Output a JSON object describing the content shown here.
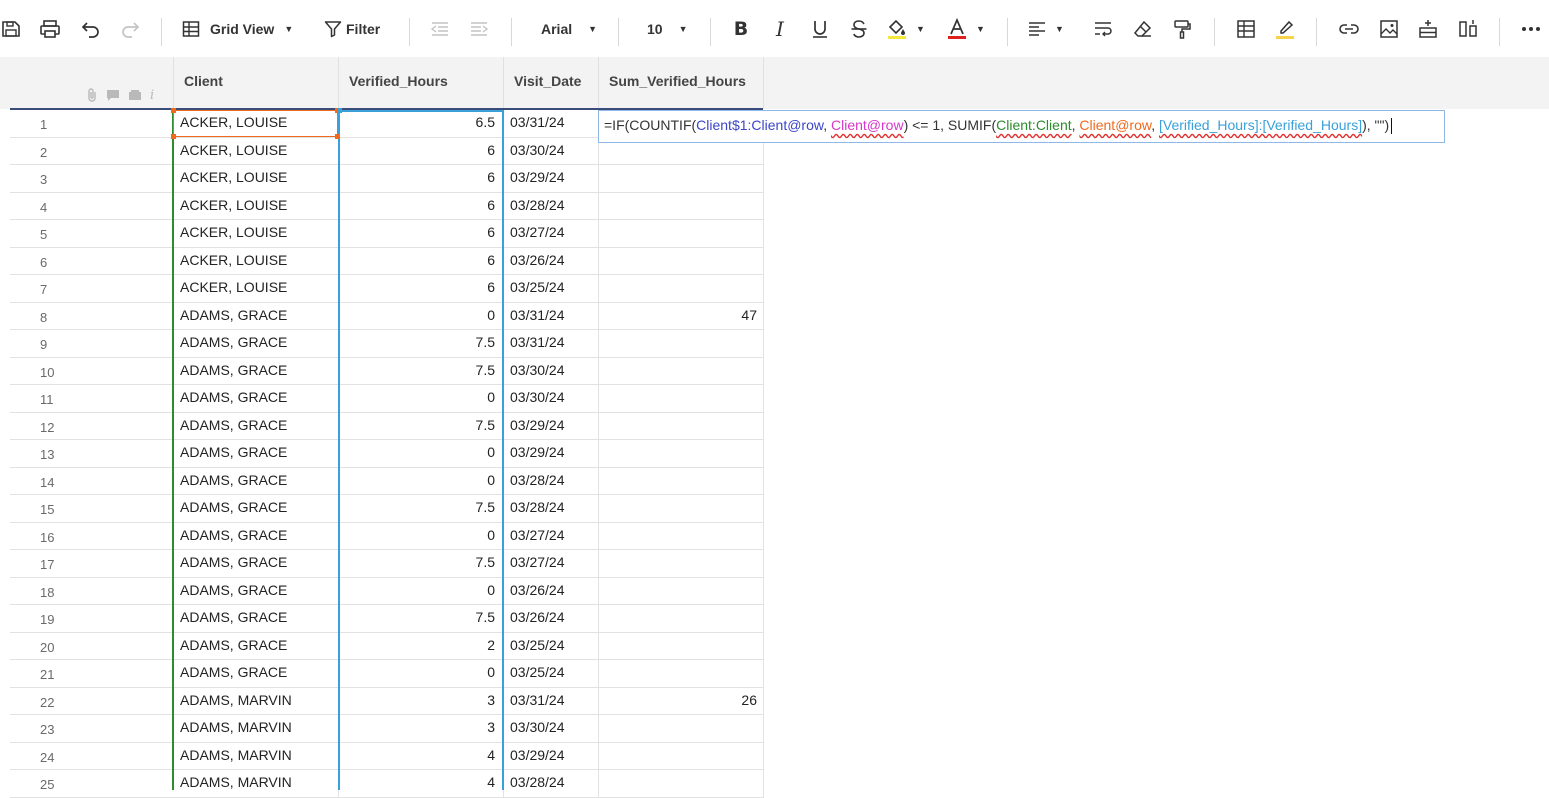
{
  "toolbar": {
    "view_label": "Grid View",
    "filter_label": "Filter",
    "font_name": "Arial",
    "font_size": "10"
  },
  "columns": {
    "client": "Client",
    "verified_hours": "Verified_Hours",
    "visit_date": "Visit_Date",
    "sum_verified_hours": "Sum_Verified_Hours"
  },
  "formula": {
    "p1": "=IF(COUNTIF(",
    "p2": "Client$1:Client@row",
    "p3": ", ",
    "p4": "Client@row",
    "p5": ") <= 1, SUMIF(",
    "p6": "Client:Client",
    "p7": ", ",
    "p8": "Client@row",
    "p9": ", ",
    "p10": "[Verified_Hours]:[Verified_Hours]",
    "p11": "), \"\")"
  },
  "rows": [
    {
      "num": "1",
      "client": "ACKER, LOUISE",
      "hours": "6.5",
      "date": "03/31/24",
      "sum": ""
    },
    {
      "num": "2",
      "client": "ACKER, LOUISE",
      "hours": "6",
      "date": "03/30/24",
      "sum": ""
    },
    {
      "num": "3",
      "client": "ACKER, LOUISE",
      "hours": "6",
      "date": "03/29/24",
      "sum": ""
    },
    {
      "num": "4",
      "client": "ACKER, LOUISE",
      "hours": "6",
      "date": "03/28/24",
      "sum": ""
    },
    {
      "num": "5",
      "client": "ACKER, LOUISE",
      "hours": "6",
      "date": "03/27/24",
      "sum": ""
    },
    {
      "num": "6",
      "client": "ACKER, LOUISE",
      "hours": "6",
      "date": "03/26/24",
      "sum": ""
    },
    {
      "num": "7",
      "client": "ACKER, LOUISE",
      "hours": "6",
      "date": "03/25/24",
      "sum": ""
    },
    {
      "num": "8",
      "client": "ADAMS, GRACE",
      "hours": "0",
      "date": "03/31/24",
      "sum": "47"
    },
    {
      "num": "9",
      "client": "ADAMS, GRACE",
      "hours": "7.5",
      "date": "03/31/24",
      "sum": ""
    },
    {
      "num": "10",
      "client": "ADAMS, GRACE",
      "hours": "7.5",
      "date": "03/30/24",
      "sum": ""
    },
    {
      "num": "11",
      "client": "ADAMS, GRACE",
      "hours": "0",
      "date": "03/30/24",
      "sum": ""
    },
    {
      "num": "12",
      "client": "ADAMS, GRACE",
      "hours": "7.5",
      "date": "03/29/24",
      "sum": ""
    },
    {
      "num": "13",
      "client": "ADAMS, GRACE",
      "hours": "0",
      "date": "03/29/24",
      "sum": ""
    },
    {
      "num": "14",
      "client": "ADAMS, GRACE",
      "hours": "0",
      "date": "03/28/24",
      "sum": ""
    },
    {
      "num": "15",
      "client": "ADAMS, GRACE",
      "hours": "7.5",
      "date": "03/28/24",
      "sum": ""
    },
    {
      "num": "16",
      "client": "ADAMS, GRACE",
      "hours": "0",
      "date": "03/27/24",
      "sum": ""
    },
    {
      "num": "17",
      "client": "ADAMS, GRACE",
      "hours": "7.5",
      "date": "03/27/24",
      "sum": ""
    },
    {
      "num": "18",
      "client": "ADAMS, GRACE",
      "hours": "0",
      "date": "03/26/24",
      "sum": ""
    },
    {
      "num": "19",
      "client": "ADAMS, GRACE",
      "hours": "7.5",
      "date": "03/26/24",
      "sum": ""
    },
    {
      "num": "20",
      "client": "ADAMS, GRACE",
      "hours": "2",
      "date": "03/25/24",
      "sum": ""
    },
    {
      "num": "21",
      "client": "ADAMS, GRACE",
      "hours": "0",
      "date": "03/25/24",
      "sum": ""
    },
    {
      "num": "22",
      "client": "ADAMS, MARVIN",
      "hours": "3",
      "date": "03/31/24",
      "sum": "26"
    },
    {
      "num": "23",
      "client": "ADAMS, MARVIN",
      "hours": "3",
      "date": "03/30/24",
      "sum": ""
    },
    {
      "num": "24",
      "client": "ADAMS, MARVIN",
      "hours": "4",
      "date": "03/29/24",
      "sum": ""
    },
    {
      "num": "25",
      "client": "ADAMS, MARVIN",
      "hours": "4",
      "date": "03/28/24",
      "sum": ""
    }
  ]
}
